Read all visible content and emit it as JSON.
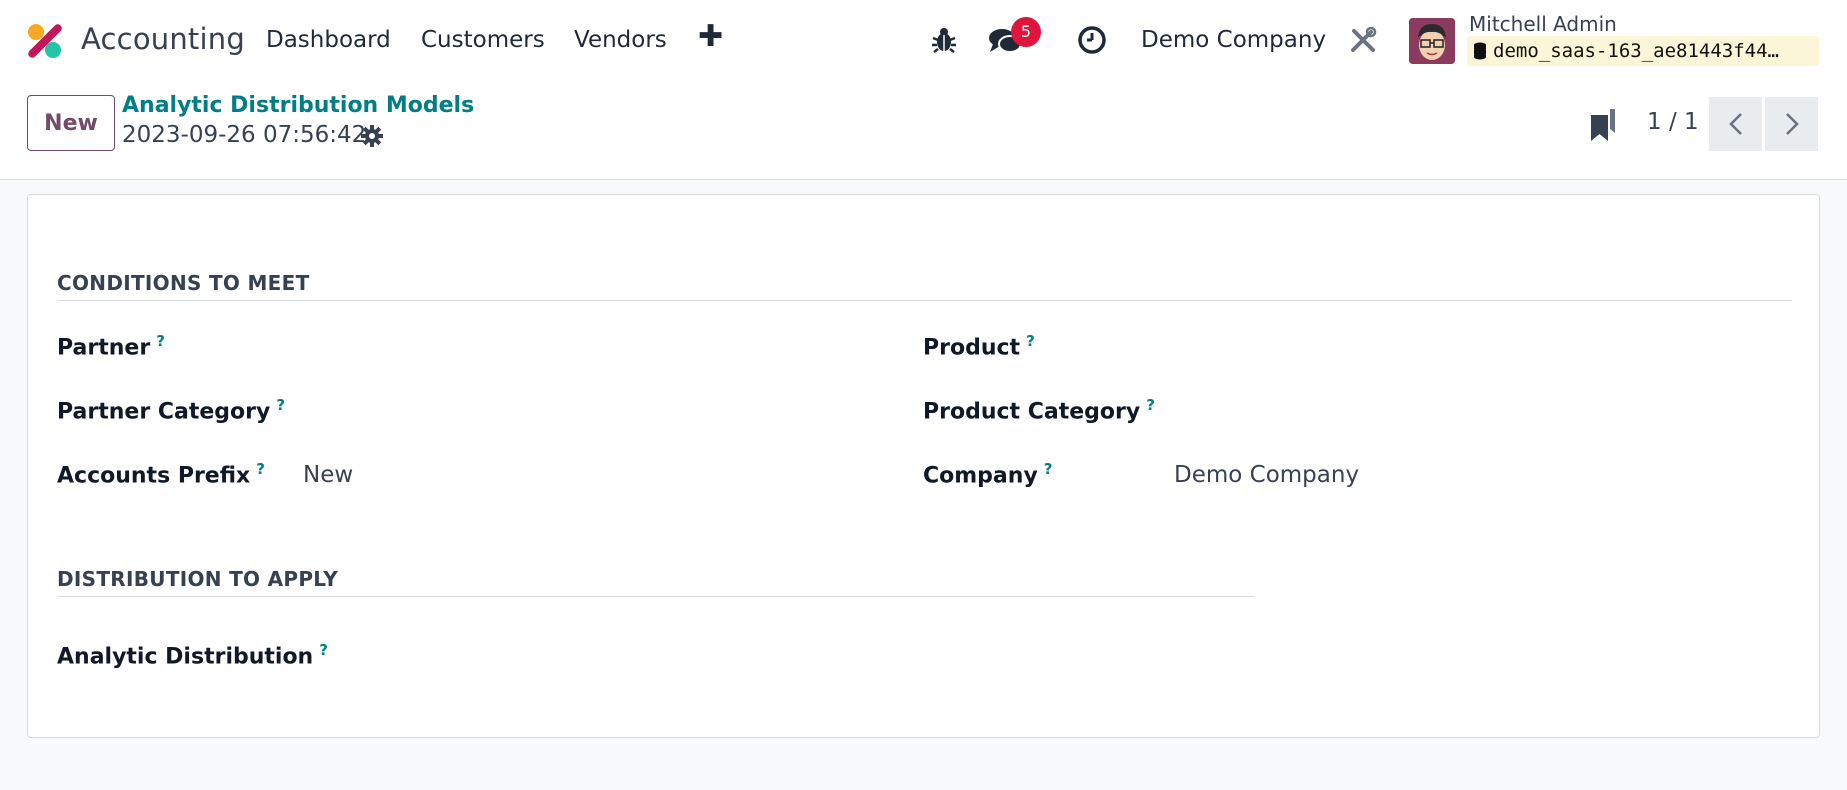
{
  "navbar": {
    "app_name": "Accounting",
    "menu": [
      "Dashboard",
      "Customers",
      "Vendors"
    ],
    "add_menu_icon": "plus-icon",
    "debug_icon": "bug-icon",
    "messages_icon": "chat-icon",
    "messages_count": "5",
    "activity_icon": "clock-icon",
    "company": "Demo Company",
    "settings_icon": "tools-icon",
    "user_name": "Mitchell Admin",
    "database": "demo_saas-163_ae81443f44…"
  },
  "control_panel": {
    "new_button": "New",
    "breadcrumb": "Analytic Distribution Models",
    "record_name": "2023-09-26 07:56:42",
    "pager_value": "1 / 1"
  },
  "form": {
    "conditions_title": "CONDITIONS TO MEET",
    "partner_label": "Partner",
    "partner_category_label": "Partner Category",
    "accounts_prefix_label": "Accounts Prefix",
    "accounts_prefix_value": "New",
    "product_label": "Product",
    "product_category_label": "Product Category",
    "company_label": "Company",
    "company_value": "Demo Company",
    "distribution_title": "DISTRIBUTION TO APPLY",
    "analytic_distribution_label": "Analytic Distribution",
    "help_mark": "?"
  },
  "colors": {
    "brand": "#714b67",
    "link": "#017e84",
    "badge": "#e0143c"
  }
}
